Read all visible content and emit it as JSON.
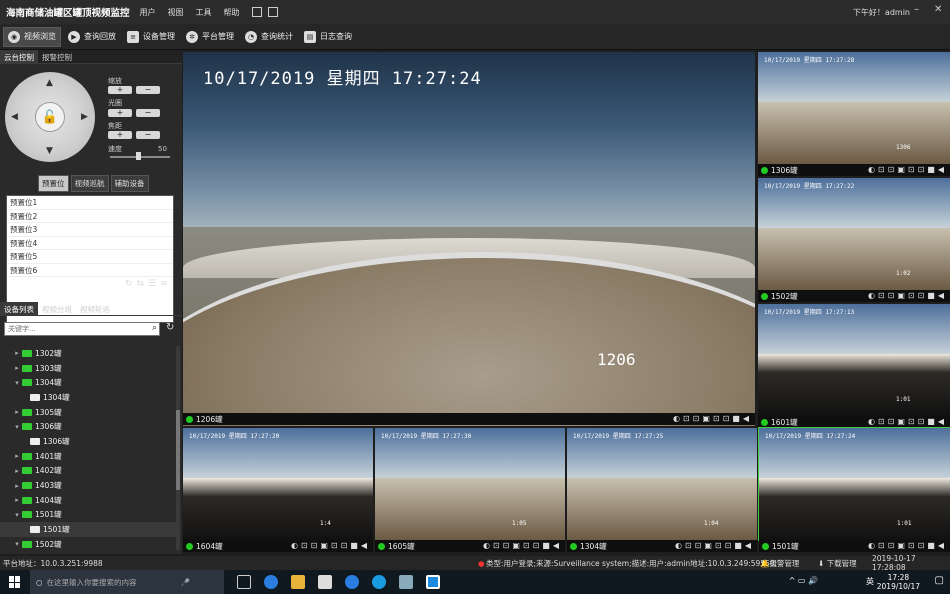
{
  "app": {
    "title": "海南商储油罐区罐顶视频监控",
    "menu": [
      "用户",
      "视图",
      "工具",
      "帮助"
    ],
    "greeting": "下午好！admin"
  },
  "toolbar": {
    "items": [
      "视频浏览",
      "查询回放",
      "设备管理",
      "平台管理",
      "查询统计",
      "日志查询"
    ]
  },
  "ptz": {
    "tabs": [
      "云台控制",
      "报警控制"
    ],
    "zoom_label": "缩放",
    "iris_label": "光圈",
    "focus_label": "焦距",
    "speed_label": "速度",
    "speed_value": "50",
    "subtabs": [
      "预置位",
      "视频巡航",
      "辅助设备"
    ],
    "presets": [
      "预置位1",
      "预置位2",
      "预置位3",
      "预置位4",
      "预置位5",
      "预置位6"
    ]
  },
  "devices": {
    "tabs": [
      "设备列表",
      "视频分组",
      "视频轮巡"
    ],
    "search_placeholder": "关键字...",
    "tree": [
      {
        "label": "1302罐",
        "level": 1,
        "expand": "▸"
      },
      {
        "label": "1303罐",
        "level": 1,
        "expand": "▸"
      },
      {
        "label": "1304罐",
        "level": 1,
        "expand": "▾"
      },
      {
        "label": "1304罐",
        "level": 2,
        "expand": ""
      },
      {
        "label": "1305罐",
        "level": 1,
        "expand": "▸"
      },
      {
        "label": "1306罐",
        "level": 1,
        "expand": "▾"
      },
      {
        "label": "1306罐",
        "level": 2,
        "expand": ""
      },
      {
        "label": "1401罐",
        "level": 1,
        "expand": "▸"
      },
      {
        "label": "1402罐",
        "level": 1,
        "expand": "▸"
      },
      {
        "label": "1403罐",
        "level": 1,
        "expand": "▸"
      },
      {
        "label": "1404罐",
        "level": 1,
        "expand": "▸"
      },
      {
        "label": "1501罐",
        "level": 1,
        "expand": "▾"
      },
      {
        "label": "1501罐",
        "level": 2,
        "expand": ""
      },
      {
        "label": "1502罐",
        "level": 1,
        "expand": "▾"
      }
    ]
  },
  "main_video": {
    "timestamp": "10/17/2019 星期四 17:27:24",
    "tank_number": "1206",
    "label": "1206罐"
  },
  "tiles": [
    {
      "label": "1306罐",
      "timestamp": "10/17/2019 星期四 17:27:28",
      "tank": "1306"
    },
    {
      "label": "1502罐",
      "timestamp": "10/17/2019 星期四 17:27:22",
      "tank": "1:02"
    },
    {
      "label": "1601罐",
      "timestamp": "10/17/2019 星期四 17:27:13",
      "tank": "1:01"
    },
    {
      "label": "1604罐",
      "timestamp": "10/17/2019 星期四 17:27:20",
      "tank": "1:4"
    },
    {
      "label": "1605罐",
      "timestamp": "10/17/2019 星期四 17:27:30",
      "tank": "1:05"
    },
    {
      "label": "1304罐",
      "timestamp": "10/17/2019 星期四 17:27:25",
      "tank": "1:04"
    },
    {
      "label": "1501罐",
      "timestamp": "10/17/2019 星期四 17:27:24",
      "tank": "1:01"
    }
  ],
  "status": {
    "platform": "平台地址：10.0.3.251:9988",
    "log": "类型:用户登录;来源:Surveillance system;描述:用户:admin地址:10.0.3.249:59550;",
    "alarm_mgmt": "报警管理",
    "download_mgmt": "下载管理",
    "datetime": "2019-10-17 17:28:08"
  },
  "taskbar": {
    "search_placeholder": "在这里输入你要搜索的内容",
    "lang": "英",
    "time": "17:28",
    "date": "2019/10/17"
  }
}
